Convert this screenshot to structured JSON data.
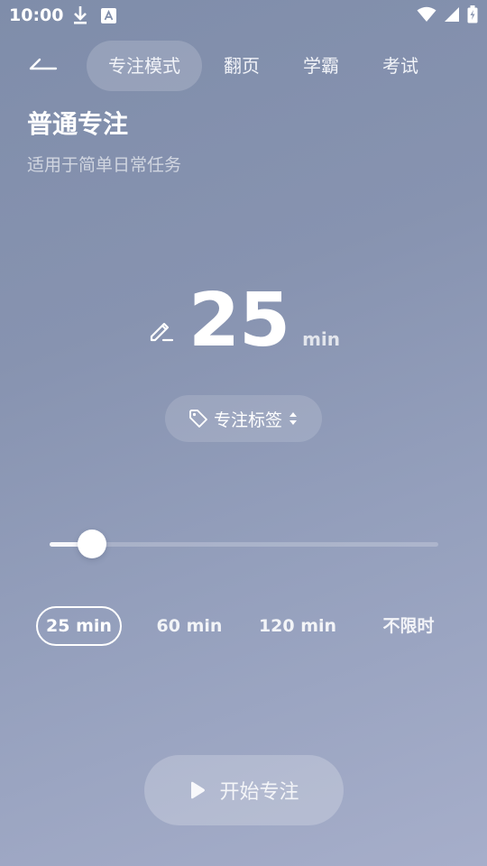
{
  "status_bar": {
    "time": "10:00"
  },
  "nav": {
    "tabs": [
      {
        "label": "专注模式",
        "active": true
      },
      {
        "label": "翻页",
        "active": false
      },
      {
        "label": "学霸",
        "active": false
      },
      {
        "label": "考试",
        "active": false
      }
    ]
  },
  "mode": {
    "title": "普通专注",
    "subtitle": "适用于简单日常任务"
  },
  "timer": {
    "value": "25",
    "unit": "min"
  },
  "tag": {
    "label": "专注标签"
  },
  "slider": {
    "fraction": 0.11
  },
  "presets": [
    {
      "label": "25 min",
      "active": true
    },
    {
      "label": "60 min",
      "active": false
    },
    {
      "label": "120 min",
      "active": false
    },
    {
      "label": "不限时",
      "active": false
    }
  ],
  "start": {
    "label": "开始专注"
  },
  "icons": [
    "download-icon",
    "a-badge-icon",
    "wifi-icon",
    "cell-signal-icon",
    "battery-icon",
    "back-arrow-icon",
    "edit-icon",
    "tag-icon",
    "sort-arrows-icon",
    "play-icon"
  ]
}
